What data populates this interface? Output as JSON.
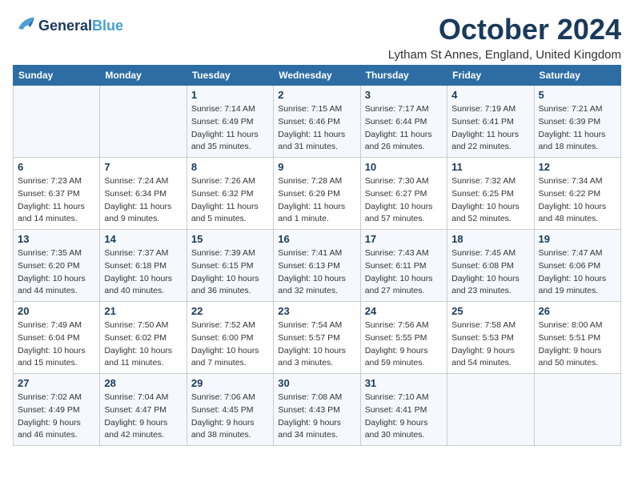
{
  "logo": {
    "line1": "General",
    "line2": "Blue"
  },
  "title": "October 2024",
  "location": "Lytham St Annes, England, United Kingdom",
  "days_header": [
    "Sunday",
    "Monday",
    "Tuesday",
    "Wednesday",
    "Thursday",
    "Friday",
    "Saturday"
  ],
  "weeks": [
    [
      {
        "num": "",
        "detail": ""
      },
      {
        "num": "",
        "detail": ""
      },
      {
        "num": "1",
        "detail": "Sunrise: 7:14 AM\nSunset: 6:49 PM\nDaylight: 11 hours and 35 minutes."
      },
      {
        "num": "2",
        "detail": "Sunrise: 7:15 AM\nSunset: 6:46 PM\nDaylight: 11 hours and 31 minutes."
      },
      {
        "num": "3",
        "detail": "Sunrise: 7:17 AM\nSunset: 6:44 PM\nDaylight: 11 hours and 26 minutes."
      },
      {
        "num": "4",
        "detail": "Sunrise: 7:19 AM\nSunset: 6:41 PM\nDaylight: 11 hours and 22 minutes."
      },
      {
        "num": "5",
        "detail": "Sunrise: 7:21 AM\nSunset: 6:39 PM\nDaylight: 11 hours and 18 minutes."
      }
    ],
    [
      {
        "num": "6",
        "detail": "Sunrise: 7:23 AM\nSunset: 6:37 PM\nDaylight: 11 hours and 14 minutes."
      },
      {
        "num": "7",
        "detail": "Sunrise: 7:24 AM\nSunset: 6:34 PM\nDaylight: 11 hours and 9 minutes."
      },
      {
        "num": "8",
        "detail": "Sunrise: 7:26 AM\nSunset: 6:32 PM\nDaylight: 11 hours and 5 minutes."
      },
      {
        "num": "9",
        "detail": "Sunrise: 7:28 AM\nSunset: 6:29 PM\nDaylight: 11 hours and 1 minute."
      },
      {
        "num": "10",
        "detail": "Sunrise: 7:30 AM\nSunset: 6:27 PM\nDaylight: 10 hours and 57 minutes."
      },
      {
        "num": "11",
        "detail": "Sunrise: 7:32 AM\nSunset: 6:25 PM\nDaylight: 10 hours and 52 minutes."
      },
      {
        "num": "12",
        "detail": "Sunrise: 7:34 AM\nSunset: 6:22 PM\nDaylight: 10 hours and 48 minutes."
      }
    ],
    [
      {
        "num": "13",
        "detail": "Sunrise: 7:35 AM\nSunset: 6:20 PM\nDaylight: 10 hours and 44 minutes."
      },
      {
        "num": "14",
        "detail": "Sunrise: 7:37 AM\nSunset: 6:18 PM\nDaylight: 10 hours and 40 minutes."
      },
      {
        "num": "15",
        "detail": "Sunrise: 7:39 AM\nSunset: 6:15 PM\nDaylight: 10 hours and 36 minutes."
      },
      {
        "num": "16",
        "detail": "Sunrise: 7:41 AM\nSunset: 6:13 PM\nDaylight: 10 hours and 32 minutes."
      },
      {
        "num": "17",
        "detail": "Sunrise: 7:43 AM\nSunset: 6:11 PM\nDaylight: 10 hours and 27 minutes."
      },
      {
        "num": "18",
        "detail": "Sunrise: 7:45 AM\nSunset: 6:08 PM\nDaylight: 10 hours and 23 minutes."
      },
      {
        "num": "19",
        "detail": "Sunrise: 7:47 AM\nSunset: 6:06 PM\nDaylight: 10 hours and 19 minutes."
      }
    ],
    [
      {
        "num": "20",
        "detail": "Sunrise: 7:49 AM\nSunset: 6:04 PM\nDaylight: 10 hours and 15 minutes."
      },
      {
        "num": "21",
        "detail": "Sunrise: 7:50 AM\nSunset: 6:02 PM\nDaylight: 10 hours and 11 minutes."
      },
      {
        "num": "22",
        "detail": "Sunrise: 7:52 AM\nSunset: 6:00 PM\nDaylight: 10 hours and 7 minutes."
      },
      {
        "num": "23",
        "detail": "Sunrise: 7:54 AM\nSunset: 5:57 PM\nDaylight: 10 hours and 3 minutes."
      },
      {
        "num": "24",
        "detail": "Sunrise: 7:56 AM\nSunset: 5:55 PM\nDaylight: 9 hours and 59 minutes."
      },
      {
        "num": "25",
        "detail": "Sunrise: 7:58 AM\nSunset: 5:53 PM\nDaylight: 9 hours and 54 minutes."
      },
      {
        "num": "26",
        "detail": "Sunrise: 8:00 AM\nSunset: 5:51 PM\nDaylight: 9 hours and 50 minutes."
      }
    ],
    [
      {
        "num": "27",
        "detail": "Sunrise: 7:02 AM\nSunset: 4:49 PM\nDaylight: 9 hours and 46 minutes."
      },
      {
        "num": "28",
        "detail": "Sunrise: 7:04 AM\nSunset: 4:47 PM\nDaylight: 9 hours and 42 minutes."
      },
      {
        "num": "29",
        "detail": "Sunrise: 7:06 AM\nSunset: 4:45 PM\nDaylight: 9 hours and 38 minutes."
      },
      {
        "num": "30",
        "detail": "Sunrise: 7:08 AM\nSunset: 4:43 PM\nDaylight: 9 hours and 34 minutes."
      },
      {
        "num": "31",
        "detail": "Sunrise: 7:10 AM\nSunset: 4:41 PM\nDaylight: 9 hours and 30 minutes."
      },
      {
        "num": "",
        "detail": ""
      },
      {
        "num": "",
        "detail": ""
      }
    ]
  ]
}
